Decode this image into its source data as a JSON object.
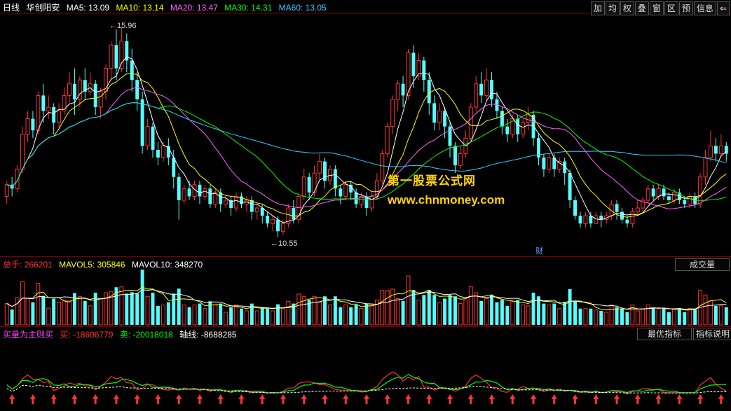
{
  "price_header": {
    "period": "日线",
    "stock": "华创阳安",
    "ma": [
      {
        "label": "MA5:",
        "value": "13.09",
        "color": "#ffffff"
      },
      {
        "label": "MA10:",
        "value": "13.14",
        "color": "#ffff00"
      },
      {
        "label": "MA20:",
        "value": "13.47",
        "color": "#ff66ff"
      },
      {
        "label": "MA30:",
        "value": "14.31",
        "color": "#00ff00"
      },
      {
        "label": "MA60:",
        "value": "13.05",
        "color": "#33ccff"
      }
    ]
  },
  "toolbar_buttons": [
    "加",
    "均",
    "权",
    "叠",
    "窗",
    "区",
    "预",
    "信息",
    "⇐"
  ],
  "high_label": "15.96",
  "low_label": "10.55",
  "finance_marker": "财",
  "watermark": {
    "line1": "第一股票公式网",
    "line2": "www.chnmoney.com"
  },
  "volume_header": {
    "total_label": "总手:",
    "total_value": "266201",
    "mavol5_label": "MAVOL5:",
    "mavol5_value": "305846",
    "mavol10_label": "MAVOL10:",
    "mavol10_value": "348270",
    "tab_label": "成交量"
  },
  "indicator_header": {
    "name": "买量为主则买",
    "buy_label": "买:",
    "buy_value": "-18606779",
    "sell_label": "卖:",
    "sell_value": "-20018018",
    "axis_label": "轴线:",
    "axis_value": "-8688285",
    "best_button": "最优指标",
    "explain_button": "指标说明"
  },
  "chart_data": {
    "type": "candlestick",
    "y_range": [
      10.2,
      16.3
    ],
    "candles": [
      [
        11.6,
        11.9,
        11.4,
        12.0
      ],
      [
        11.9,
        11.8,
        11.6,
        12.1
      ],
      [
        11.8,
        12.3,
        11.7,
        12.4
      ],
      [
        12.3,
        13.2,
        12.2,
        13.4
      ],
      [
        13.2,
        13.6,
        13.0,
        13.8
      ],
      [
        13.6,
        13.3,
        13.1,
        13.8
      ],
      [
        13.3,
        14.2,
        13.2,
        14.3
      ],
      [
        14.2,
        13.8,
        13.5,
        14.5
      ],
      [
        13.8,
        13.9,
        13.6,
        14.2
      ],
      [
        13.9,
        13.5,
        13.2,
        14.0
      ],
      [
        13.5,
        13.8,
        13.3,
        14.0
      ],
      [
        13.8,
        14.2,
        13.7,
        14.4
      ],
      [
        14.2,
        14.5,
        14.0,
        14.8
      ],
      [
        14.5,
        14.1,
        13.7,
        14.9
      ],
      [
        14.1,
        14.6,
        13.9,
        14.7
      ],
      [
        14.6,
        14.3,
        14.1,
        14.9
      ],
      [
        14.3,
        14.5,
        14.2,
        14.8
      ],
      [
        14.5,
        13.9,
        13.7,
        14.6
      ],
      [
        13.9,
        14.3,
        13.6,
        14.4
      ],
      [
        14.3,
        14.9,
        14.1,
        15.0
      ],
      [
        14.9,
        15.5,
        14.6,
        15.6
      ],
      [
        15.5,
        14.9,
        14.6,
        15.9
      ],
      [
        14.9,
        15.6,
        14.8,
        15.96
      ],
      [
        15.6,
        15.1,
        14.8,
        15.8
      ],
      [
        15.1,
        14.6,
        14.3,
        15.4
      ],
      [
        14.6,
        14.1,
        13.8,
        14.8
      ],
      [
        14.1,
        12.9,
        12.7,
        14.3
      ],
      [
        12.9,
        13.4,
        12.8,
        13.6
      ],
      [
        13.4,
        12.8,
        12.6,
        13.5
      ],
      [
        12.8,
        12.6,
        12.4,
        13.0
      ],
      [
        12.6,
        12.9,
        12.5,
        13.0
      ],
      [
        12.9,
        12.6,
        12.4,
        13.1
      ],
      [
        12.6,
        12.1,
        11.8,
        12.8
      ],
      [
        12.1,
        11.5,
        11.0,
        12.2
      ],
      [
        11.5,
        11.8,
        11.4,
        11.9
      ],
      [
        11.8,
        11.6,
        11.5,
        12.0
      ],
      [
        11.6,
        11.9,
        11.5,
        12.0
      ],
      [
        11.9,
        11.6,
        11.4,
        12.0
      ],
      [
        11.6,
        11.8,
        11.5,
        11.9
      ],
      [
        11.8,
        11.4,
        11.3,
        11.9
      ],
      [
        11.4,
        11.7,
        11.3,
        11.8
      ],
      [
        11.7,
        11.4,
        11.2,
        11.8
      ],
      [
        11.4,
        11.5,
        11.3,
        11.6
      ],
      [
        11.5,
        11.3,
        11.1,
        11.6
      ],
      [
        11.3,
        11.6,
        11.2,
        11.7
      ],
      [
        11.6,
        11.4,
        11.3,
        11.7
      ],
      [
        11.4,
        11.5,
        11.2,
        11.6
      ],
      [
        11.5,
        11.2,
        11.0,
        11.6
      ],
      [
        11.2,
        11.3,
        11.0,
        11.4
      ],
      [
        11.3,
        11.1,
        10.9,
        11.4
      ],
      [
        11.1,
        10.9,
        10.8,
        11.2
      ],
      [
        10.9,
        11.0,
        10.7,
        11.1
      ],
      [
        11.0,
        10.7,
        10.55,
        11.1
      ],
      [
        10.7,
        10.9,
        10.6,
        11.0
      ],
      [
        10.9,
        11.3,
        10.8,
        11.4
      ],
      [
        11.3,
        11.0,
        10.9,
        11.5
      ],
      [
        11.0,
        11.6,
        10.9,
        11.7
      ],
      [
        11.6,
        12.1,
        11.5,
        12.3
      ],
      [
        12.1,
        11.7,
        11.5,
        12.2
      ],
      [
        11.7,
        12.2,
        11.6,
        12.4
      ],
      [
        12.2,
        12.5,
        12.0,
        12.7
      ],
      [
        12.5,
        12.0,
        11.8,
        12.6
      ],
      [
        12.0,
        12.3,
        11.9,
        12.4
      ],
      [
        12.3,
        11.8,
        11.6,
        12.4
      ],
      [
        11.8,
        11.6,
        11.4,
        11.9
      ],
      [
        11.6,
        11.9,
        11.5,
        12.0
      ],
      [
        11.9,
        11.7,
        11.5,
        12.0
      ],
      [
        11.7,
        11.4,
        11.3,
        11.8
      ],
      [
        11.4,
        11.6,
        11.3,
        11.7
      ],
      [
        11.6,
        11.3,
        11.1,
        11.7
      ],
      [
        11.3,
        11.6,
        11.2,
        11.7
      ],
      [
        11.6,
        12.0,
        11.5,
        12.2
      ],
      [
        12.0,
        12.7,
        11.9,
        12.8
      ],
      [
        12.7,
        13.4,
        12.6,
        13.5
      ],
      [
        13.4,
        14.1,
        13.2,
        14.2
      ],
      [
        14.1,
        14.5,
        13.8,
        14.6
      ],
      [
        14.5,
        14.2,
        13.9,
        14.7
      ],
      [
        14.2,
        15.3,
        14.1,
        15.4
      ],
      [
        15.3,
        14.7,
        14.4,
        15.5
      ],
      [
        14.7,
        15.1,
        14.6,
        15.3
      ],
      [
        15.1,
        14.6,
        14.3,
        15.2
      ],
      [
        14.6,
        14.0,
        13.7,
        14.8
      ],
      [
        14.0,
        13.5,
        13.3,
        14.2
      ],
      [
        13.5,
        13.8,
        13.3,
        14.0
      ],
      [
        13.8,
        13.4,
        13.1,
        13.9
      ],
      [
        13.4,
        12.9,
        12.6,
        13.5
      ],
      [
        12.9,
        12.4,
        12.2,
        13.0
      ],
      [
        12.4,
        12.7,
        12.3,
        12.9
      ],
      [
        12.7,
        13.1,
        12.6,
        13.3
      ],
      [
        13.1,
        13.9,
        13.0,
        14.0
      ],
      [
        13.9,
        14.5,
        13.8,
        14.7
      ],
      [
        14.5,
        14.2,
        14.0,
        14.8
      ],
      [
        14.2,
        14.6,
        14.1,
        14.9
      ],
      [
        14.6,
        14.1,
        13.9,
        14.8
      ],
      [
        14.1,
        13.8,
        13.6,
        14.3
      ],
      [
        13.8,
        13.4,
        13.2,
        13.9
      ],
      [
        13.4,
        13.2,
        13.0,
        13.6
      ],
      [
        13.2,
        13.6,
        13.1,
        13.7
      ],
      [
        13.6,
        13.2,
        13.0,
        13.7
      ],
      [
        13.2,
        13.5,
        13.1,
        13.6
      ],
      [
        13.5,
        13.7,
        13.3,
        13.9
      ],
      [
        13.7,
        13.1,
        12.9,
        13.8
      ],
      [
        13.1,
        12.6,
        12.4,
        13.2
      ],
      [
        12.6,
        12.3,
        12.1,
        12.7
      ],
      [
        12.3,
        12.6,
        12.2,
        12.7
      ],
      [
        12.6,
        12.3,
        12.1,
        12.7
      ],
      [
        12.3,
        12.5,
        12.2,
        12.6
      ],
      [
        12.5,
        12.2,
        11.9,
        12.6
      ],
      [
        12.2,
        11.5,
        11.3,
        12.3
      ],
      [
        11.5,
        11.1,
        11.0,
        11.6
      ],
      [
        11.1,
        10.9,
        10.8,
        11.2
      ],
      [
        10.9,
        11.1,
        10.8,
        11.2
      ],
      [
        11.1,
        10.9,
        10.8,
        11.2
      ],
      [
        10.9,
        11.1,
        10.9,
        11.2
      ],
      [
        11.1,
        11.0,
        10.8,
        11.2
      ],
      [
        11.0,
        11.1,
        10.9,
        11.2
      ],
      [
        11.1,
        11.4,
        11.0,
        11.5
      ],
      [
        11.4,
        11.2,
        11.0,
        11.5
      ],
      [
        11.2,
        11.0,
        10.9,
        11.3
      ],
      [
        11.0,
        10.9,
        10.8,
        11.1
      ],
      [
        10.9,
        11.2,
        10.8,
        11.3
      ],
      [
        11.2,
        11.3,
        11.1,
        11.5
      ],
      [
        11.3,
        11.5,
        11.2,
        11.6
      ],
      [
        11.5,
        11.8,
        11.4,
        11.9
      ],
      [
        11.8,
        11.6,
        11.5,
        11.9
      ],
      [
        11.6,
        11.8,
        11.5,
        11.9
      ],
      [
        11.8,
        11.6,
        11.5,
        11.9
      ],
      [
        11.6,
        11.5,
        11.4,
        11.7
      ],
      [
        11.5,
        11.7,
        11.4,
        11.8
      ],
      [
        11.7,
        11.5,
        11.4,
        11.8
      ],
      [
        11.5,
        11.4,
        11.3,
        11.6
      ],
      [
        11.4,
        11.6,
        11.3,
        11.7
      ],
      [
        11.6,
        11.4,
        11.3,
        11.7
      ],
      [
        11.4,
        12.1,
        11.3,
        12.2
      ],
      [
        12.1,
        12.6,
        11.9,
        12.8
      ],
      [
        12.6,
        12.9,
        12.5,
        13.3
      ],
      [
        12.9,
        12.7,
        12.5,
        13.1
      ],
      [
        12.7,
        12.9,
        12.6,
        13.2
      ],
      [
        12.9,
        12.7,
        12.5,
        13.0
      ]
    ]
  }
}
